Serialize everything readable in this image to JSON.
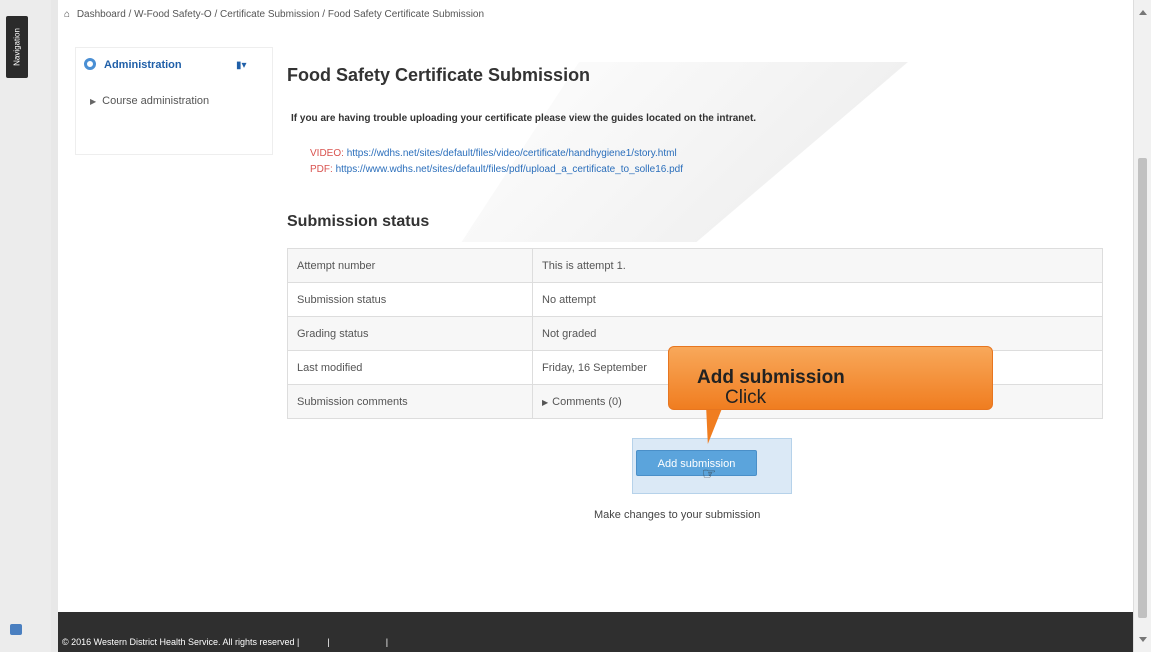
{
  "navigation": {
    "tab_label": "Navigation"
  },
  "breadcrumb": {
    "text": "Dashboard / W-Food Safety-O / Certificate Submission / Food Safety Certificate Submission"
  },
  "sidebar": {
    "header": "Administration",
    "items": [
      {
        "label": "Course administration"
      }
    ]
  },
  "main": {
    "title": "Food Safety Certificate Submission",
    "trouble_text": "If you are having trouble uploading your certificate please view the guides located on the intranet.",
    "links": [
      {
        "label": "VIDEO:",
        "url": "https://wdhs.net/sites/default/files/video/certificate/handhygiene1/story.html"
      },
      {
        "label": "PDF:",
        "url": "https://www.wdhs.net/sites/default/files/pdf/upload_a_certificate_to_solle16.pdf"
      }
    ],
    "status_heading": "Submission status",
    "status_rows": [
      {
        "key": "Attempt number",
        "value": "This is attempt 1."
      },
      {
        "key": "Submission status",
        "value": "No attempt"
      },
      {
        "key": "Grading status",
        "value": "Not graded"
      },
      {
        "key": "Last modified",
        "value": "Friday, 16 September"
      },
      {
        "key": "Submission comments",
        "value": "Comments (0)"
      }
    ],
    "add_button": "Add submission",
    "help_text": "Make changes to your submission"
  },
  "callout": {
    "prefix": "Click",
    "bold": "Add submission"
  },
  "footer": {
    "copyright": "© 2016 Western District Health Service. All rights reserved |"
  },
  "colors": {
    "accent": "#5ba4dc",
    "callout": "#f07d20",
    "link": "#2a6ebb",
    "link_label": "#d9534f"
  }
}
